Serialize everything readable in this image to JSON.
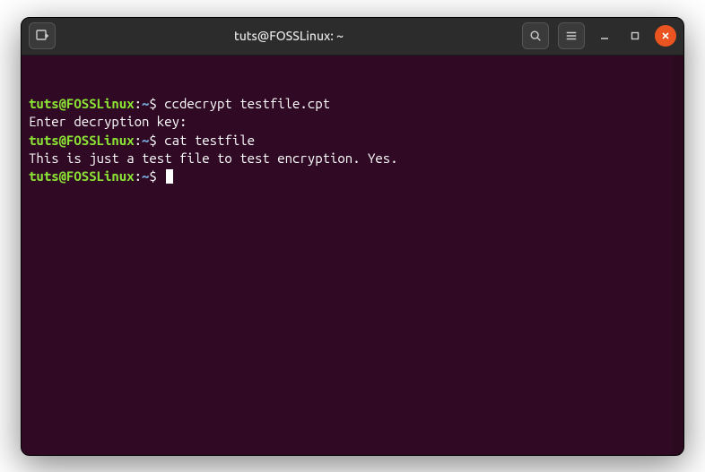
{
  "titlebar": {
    "title": "tuts@FOSSLinux: ~"
  },
  "prompt": {
    "user_host": "tuts@FOSSLinux",
    "colon": ":",
    "path": "~",
    "symbol": "$"
  },
  "lines": {
    "cmd1": "ccdecrypt testfile.cpt",
    "out1": "Enter decryption key:",
    "cmd2": "cat testfile",
    "out2": "This is just a test file to test encryption. Yes."
  }
}
